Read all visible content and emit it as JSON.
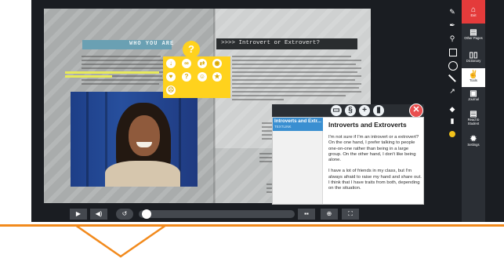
{
  "book": {
    "left_heading": "WHO YOU ARE",
    "right_heading": ">>>> Introvert or Extrovert?"
  },
  "annotation_popup": {
    "top_icon": "?",
    "icons": [
      "pin-icon",
      "link-icon",
      "swap-icon",
      "eye-icon",
      "heart-icon",
      "question-icon",
      "smile-icon",
      "star-icon",
      "sad-icon"
    ]
  },
  "glossary": {
    "toolbar_icons": [
      "comment-icon",
      "section-icon",
      "plus-icon",
      "trash-icon"
    ],
    "close": "✕",
    "entry_title": "Introverts and Extr...",
    "entry_sub": "TEXTLINK",
    "title": "Introverts and Extroverts",
    "paragraph_1": "I'm not sure if I'm an introvert or a extrovert? On the one hand, I prefer talking to people one-on-one rather than being in a large group. On the other hand, I don't like being alone.",
    "paragraph_2": "I have a lot of friends in my class, but I'm always afraid to raise my hand and share out. I think that I have traits from both, depending on the situation."
  },
  "player": {
    "play": "▶",
    "volume": "◀)",
    "rewind": "↺",
    "slide": "▪▪",
    "zoom": "⊕",
    "fullscreen": "⛶"
  },
  "tools": [
    "brush-icon",
    "pen-icon",
    "marker-icon",
    "square-icon",
    "circle-icon",
    "line-icon",
    "arrow-icon",
    "eraser-icon",
    "trash-icon",
    "color-dot"
  ],
  "sidebar": {
    "exit": "Exit",
    "other_pages": "Other Pages",
    "dictionary": "Dictionary",
    "tools": "Tools",
    "journal": "Journal",
    "read_to_student": "Read to Student",
    "settings": "Settings"
  },
  "colors": {
    "accent_orange": "#f28a1c",
    "annotation_yellow": "#ffd21d",
    "exit_red": "#e43b3b",
    "glossary_blue": "#3a8fd1"
  }
}
